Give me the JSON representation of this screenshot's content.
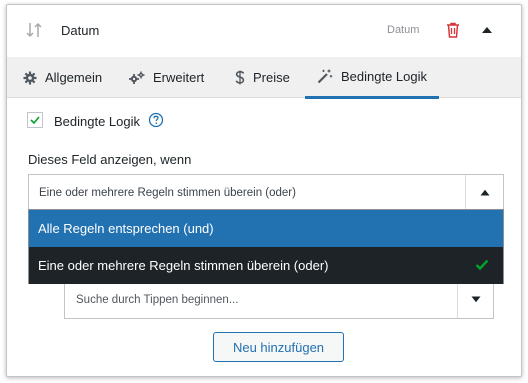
{
  "header": {
    "title": "Datum",
    "field_type": "Datum",
    "sort_icon": "sort-arrows-icon",
    "delete_icon": "trash-icon",
    "collapse_icon": "caret-up-icon"
  },
  "tabs": [
    {
      "label": "Allgemein",
      "icon": "gear-icon",
      "active": false
    },
    {
      "label": "Erweitert",
      "icon": "gears-icon",
      "active": false
    },
    {
      "label": "Preise",
      "icon": "dollar-icon",
      "active": false
    },
    {
      "label": "Bedingte Logik",
      "icon": "magic-wand-icon",
      "active": true
    }
  ],
  "conditional": {
    "checkbox_label": "Bedingte Logik",
    "checked": true,
    "show_label": "Dieses Feld anzeigen, wenn",
    "selected": "Eine oder mehrere Regeln stimmen überein (oder)",
    "options": [
      "Alle Regeln entsprechen (und)",
      "Eine oder mehrere Regeln stimmen überein (oder)"
    ],
    "search_placeholder": "Suche durch Tippen beginnen...",
    "add_button": "Neu hinzufügen"
  },
  "colors": {
    "accent": "#2271b1",
    "danger": "#d63638",
    "success": "#00a32a",
    "dropdown_highlight": "#2271b1",
    "dropdown_selected_bg": "#1d2327"
  }
}
